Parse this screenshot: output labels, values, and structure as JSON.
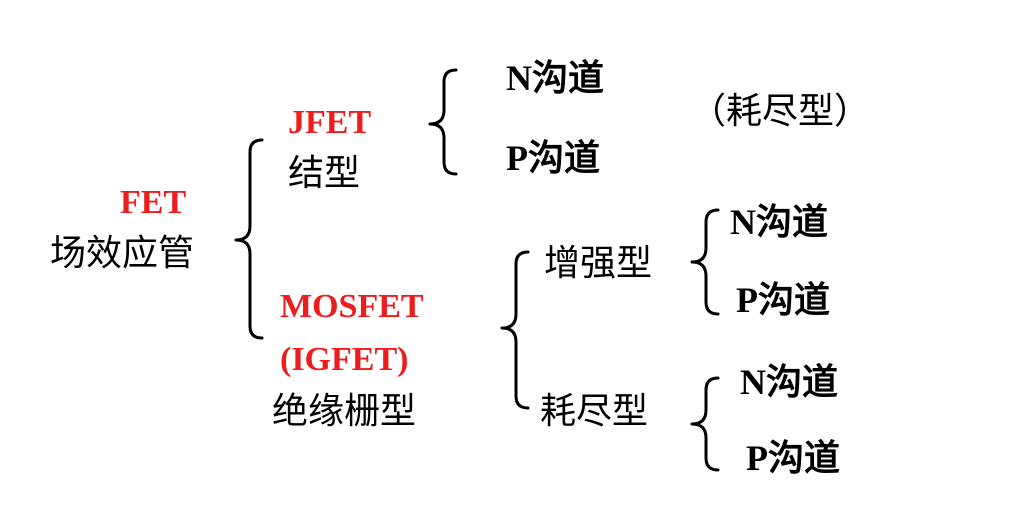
{
  "root": {
    "abbr": "FET",
    "name": "场效应管"
  },
  "jfet": {
    "abbr": "JFET",
    "name": "结型",
    "channels": [
      "N沟道",
      "P沟道"
    ],
    "note": "（耗尽型）"
  },
  "mosfet": {
    "abbr": "MOSFET",
    "abbr2": "(IGFET)",
    "name": "绝缘栅型",
    "enhancement": {
      "name": "增强型",
      "channels": [
        "N沟道",
        "P沟道"
      ]
    },
    "depletion": {
      "name": "耗尽型",
      "channels": [
        "N沟道",
        "P沟道"
      ]
    }
  },
  "colors": {
    "accent": "#ee1c1c",
    "text": "#000000"
  }
}
